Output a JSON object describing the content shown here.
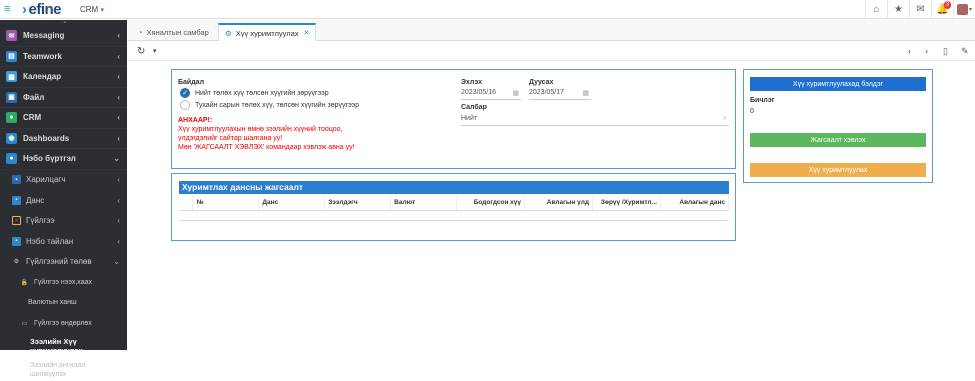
{
  "topbar": {
    "logo": "efine",
    "module": "CRM",
    "notification_count": "3"
  },
  "sidebar": {
    "items": [
      {
        "label": "Messaging",
        "color": "#9b59b6"
      },
      {
        "label": "Teamwork",
        "color": "#2b88c9"
      },
      {
        "label": "Календар",
        "color": "#2b88c9"
      },
      {
        "label": "Файл",
        "color": "#2b6cb0"
      },
      {
        "label": "CRM",
        "color": "#27ae60"
      },
      {
        "label": "Dashboards",
        "color": "#2b88c9"
      },
      {
        "label": "Нэбо бүртгэл",
        "color": "#2b88c9"
      }
    ],
    "sub": [
      {
        "label": "Харилцагч"
      },
      {
        "label": "Данс"
      },
      {
        "label": "Гүйлгээ"
      },
      {
        "label": "Нэбо тайлан"
      },
      {
        "label": "Гүйлгээний төлөв"
      }
    ],
    "sub2": [
      {
        "label": "Гүйлгээ нээх,хаах"
      },
      {
        "label": "Валютын ханш"
      },
      {
        "label": "Гүйлгээ өндөрлөх"
      }
    ],
    "active": "Зээлийн Хүү хуримтлуулах",
    "last": "Зээлийн ангилал шилжүүлэх"
  },
  "tabs": [
    {
      "label": "Хяналтын самбар"
    },
    {
      "label": "Хүү хуримтлуулах"
    }
  ],
  "form": {
    "type_label": "Байдал",
    "radio1": "Нийт төлөх хүү төлсөн хүүгийн зөрүүгээр",
    "radio2": "Тухайн сарын төлөх хүү, төлсөн хүүгийн зөрүүгээр",
    "warn1": "АНХААР!:",
    "warn2": "Хүү хуримтлуулахын өмнө зээлийн хүүний тооцоо,",
    "warn3": "үлдэгдэлийг сайтар шалгана уу!",
    "warn4": "Мөн 'ЖАГСААЛТ ХЭВЛЭХ' командаар хэвлэж авна уу!",
    "start_label": "Эхлэх",
    "start_value": "2023/05/16",
    "end_label": "Дуусах",
    "end_value": "2023/05/17",
    "branch_label": "Салбар",
    "branch_value": "Нийт"
  },
  "table": {
    "title": "Хуримтлах дансны жагсаалт",
    "columns": [
      "",
      "№",
      "Данс",
      "Зээлдэгч",
      "Валют",
      "Бодогдсон хүү",
      "Авлагын үлд",
      "Зөрүү /Хуримтл...",
      "Авлагын данс"
    ]
  },
  "side": {
    "btn_prepare": "Хүү хуримтлуулахад бэлдэг",
    "record_label": "Бичлэг",
    "record_count": "0",
    "btn_print": "Жагсаалт хэвлэх",
    "btn_accrue": "Хүү хуримтлуулах"
  },
  "colors": {
    "accent": "#2a7fd1",
    "green": "#5cb85c",
    "orange": "#f0ad4e"
  }
}
